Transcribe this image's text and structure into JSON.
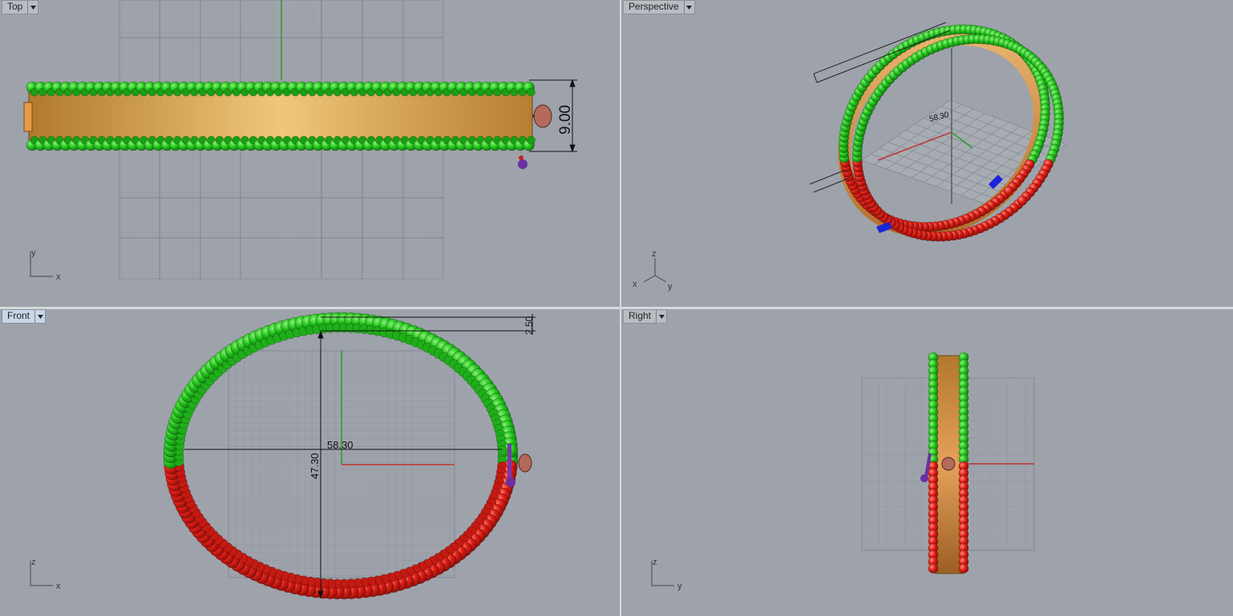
{
  "viewports": {
    "top": {
      "label": "Top",
      "axes": [
        "y",
        "x"
      ],
      "dimension": "9.00"
    },
    "perspective": {
      "label": "Perspective",
      "axes": [
        "z",
        "x",
        "y"
      ],
      "dimension": "58.30"
    },
    "front": {
      "label": "Front",
      "axes": [
        "z",
        "x"
      ],
      "dim_width": "58.30",
      "dim_height": "47.30",
      "dim_gap": "2.50"
    },
    "right": {
      "label": "Right",
      "axes": [
        "z",
        "y"
      ]
    }
  },
  "colors": {
    "viewport_bg": "#9ea3ab",
    "grid": "#8c9199",
    "bead_green": "#2fcf2a",
    "bead_red": "#e2231a",
    "band_gold": "#d9a451",
    "axis_x": "#c03535",
    "axis_y": "#2f9a2f"
  },
  "icons": {
    "dropdown": "chevron-down-icon"
  }
}
